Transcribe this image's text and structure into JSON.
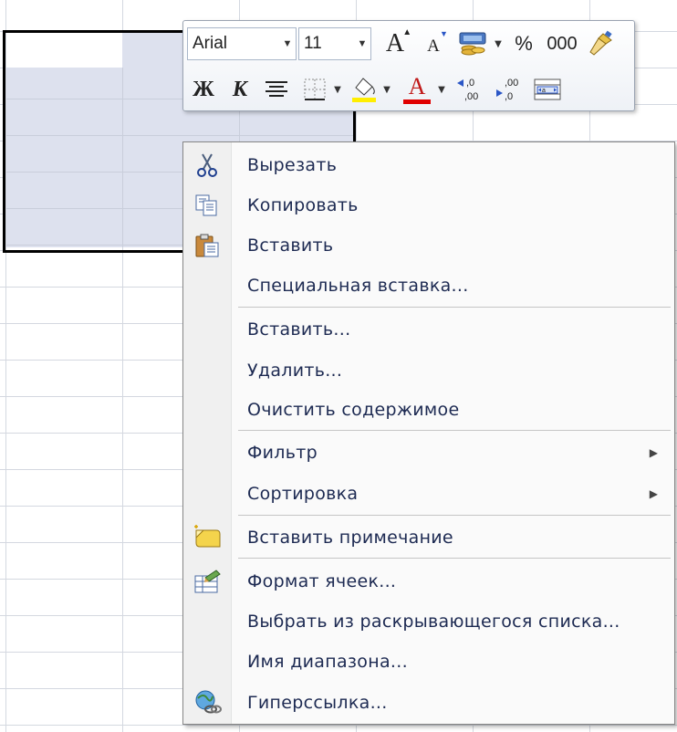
{
  "toolbar": {
    "font_name": "Arial",
    "font_size": "11",
    "percent_label": "%",
    "thousands_label": "000",
    "bold_label": "Ж",
    "italic_label": "К",
    "grow_font_label": "A",
    "shrink_font_label": "A",
    "font_color_label": "A",
    "highlight_color": "#ffee00",
    "font_color": "#e00000",
    "icons": [
      "grow-font-icon",
      "shrink-font-icon",
      "accounting-format-icon",
      "percent-style-icon",
      "comma-style-icon",
      "format-painter-icon",
      "center-align-icon",
      "borders-icon",
      "fill-color-icon",
      "font-color-icon",
      "increase-decimal-icon",
      "decrease-decimal-icon",
      "merge-center-icon"
    ]
  },
  "menu": {
    "items": [
      {
        "label": "Вырезать",
        "icon": "scissors-icon"
      },
      {
        "label": "Копировать",
        "icon": "copy-icon"
      },
      {
        "label": "Вставить",
        "icon": "paste-icon"
      },
      {
        "label": "Специальная вставка...",
        "icon": ""
      },
      {
        "label": "Вставить...",
        "icon": ""
      },
      {
        "label": "Удалить...",
        "icon": ""
      },
      {
        "label": "Очистить содержимое",
        "icon": ""
      },
      {
        "label": "Фильтр",
        "icon": ""
      },
      {
        "label": "Сортировка",
        "icon": ""
      },
      {
        "label": "Вставить примечание",
        "icon": "insert-comment-icon"
      },
      {
        "label": "Формат ячеек...",
        "icon": "format-cells-icon"
      },
      {
        "label": "Выбрать из раскрывающегося списка...",
        "icon": ""
      },
      {
        "label": "Имя диапазона...",
        "icon": ""
      },
      {
        "label": "Гиперссылка...",
        "icon": "hyperlink-icon"
      }
    ]
  },
  "colors": {
    "menu_text": "#1d2a52",
    "selection_fill": "#dde1ee",
    "grid_line": "#d4d8e0"
  }
}
